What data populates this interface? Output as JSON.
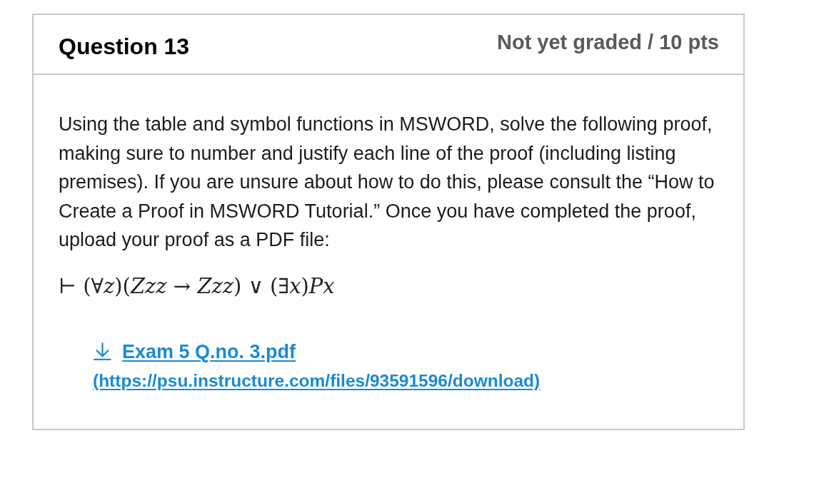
{
  "question": {
    "title": "Question 13",
    "score": "Not yet graded / 10 pts"
  },
  "body": {
    "prompt": "Using the table and symbol functions in MSWORD, solve the following proof, making sure to number and justify each line of the proof (including listing premises). If you are unsure about how to do this, please consult the “How to Create a Proof in MSWORD Tutorial.” Once you have completed the proof, upload your proof as a PDF file:",
    "formula": "⊢ (∀*z*)(*Zzz* → *Zzz*) ∨ (∃*x*)*Px*",
    "attachment": {
      "filename": "Exam 5 Q.no. 3.pdf",
      "url": "(https://psu.instructure.com/files/93591596/download)"
    }
  }
}
